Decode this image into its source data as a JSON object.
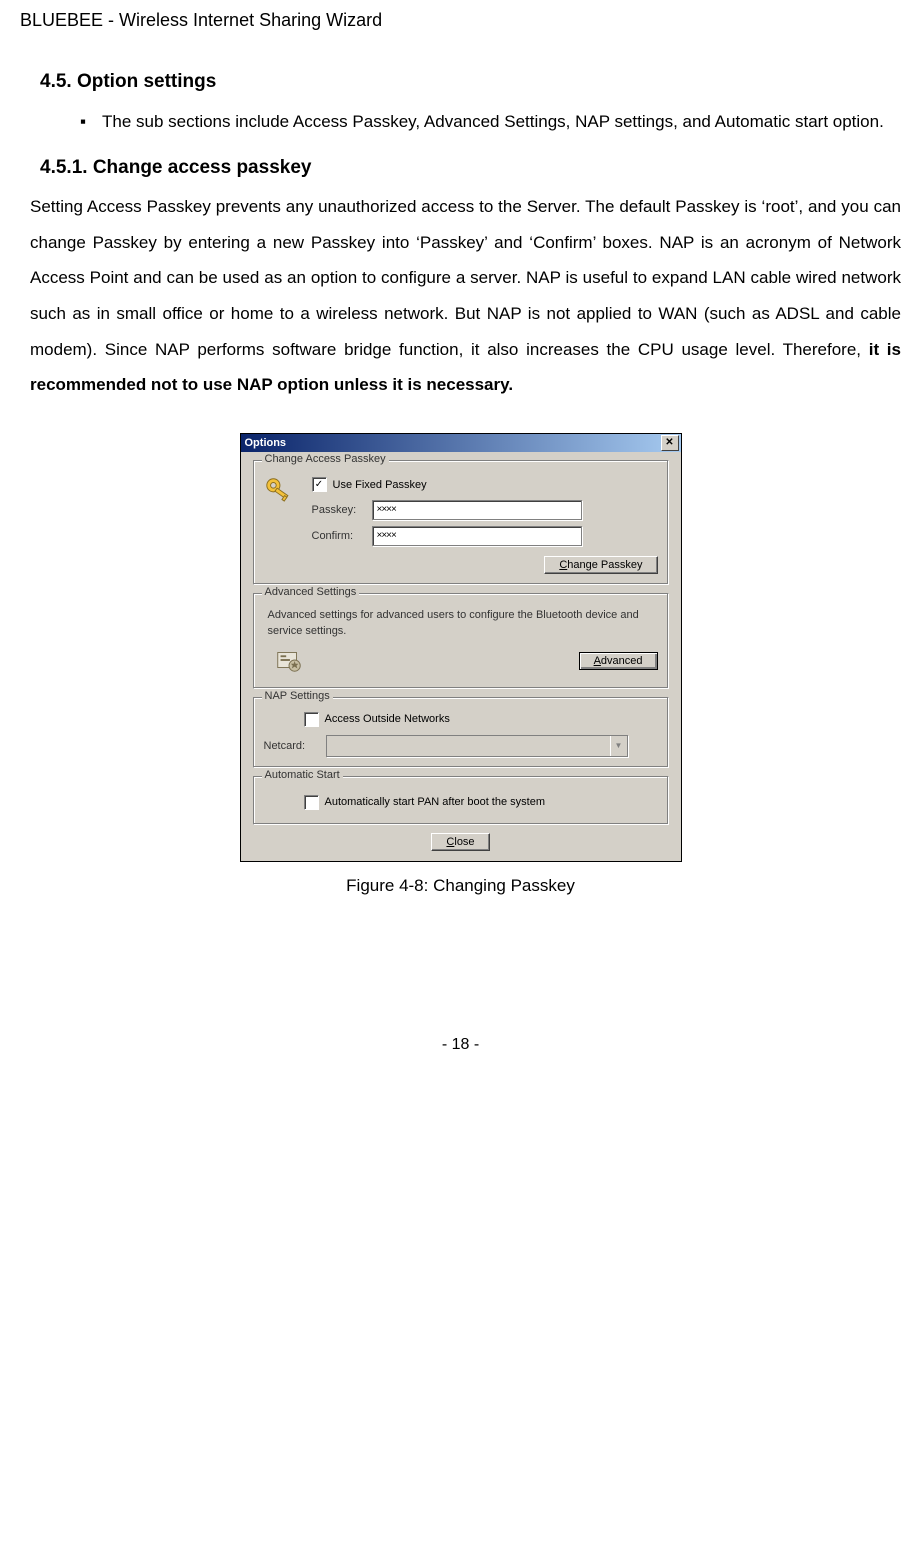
{
  "doc_header": "BLUEBEE - Wireless Internet Sharing Wizard",
  "section_title": "4.5. Option settings",
  "bullet_mark": "▪",
  "bullet_text": "The sub sections include Access Passkey, Advanced Settings, NAP settings, and Automatic start option.",
  "subsection_title": "4.5.1. Change access passkey",
  "body_part1": "Setting Access Passkey prevents any unauthorized access to the Server. The  default Passkey is ‘root’, and you can change Passkey by entering a new Passkey into ‘Passkey’ and ‘Confirm’ boxes. NAP is an acronym of Network Access Point and can be used as an option to configure a server. NAP is useful to expand LAN cable wired network such as in small office or home to a wireless network. But NAP is not applied to WAN (such as ADSL and cable modem). Since NAP performs software bridge function, it also increases the CPU usage level. Therefore, ",
  "body_bold": "it is recommended not to use NAP option unless it is necessary.",
  "dialog": {
    "title": "Options",
    "close_x": "✕",
    "group_passkey": {
      "legend": "Change Access Passkey",
      "use_fixed_label": "Use Fixed Passkey",
      "use_fixed_checked": "✓",
      "passkey_label": "Passkey:",
      "passkey_value": "××××",
      "confirm_label": "Confirm:",
      "confirm_value": "××××",
      "change_btn_pre": "C",
      "change_btn_rest": "hange Passkey"
    },
    "group_advanced": {
      "legend": "Advanced Settings",
      "desc": "Advanced settings for advanced users to configure the Bluetooth device and service settings.",
      "btn_pre": "A",
      "btn_rest": "dvanced"
    },
    "group_nap": {
      "legend": "NAP Settings",
      "access_outside_label": "Access Outside Networks",
      "netcard_label": "Netcard:",
      "combo_arrow": "▼"
    },
    "group_auto": {
      "legend": "Automatic Start",
      "auto_label": "Automatically start PAN after boot the system"
    },
    "close_btn_pre": "C",
    "close_btn_rest": "lose"
  },
  "figure_caption": "Figure 4-8: Changing Passkey",
  "page_number": "- 18 -"
}
